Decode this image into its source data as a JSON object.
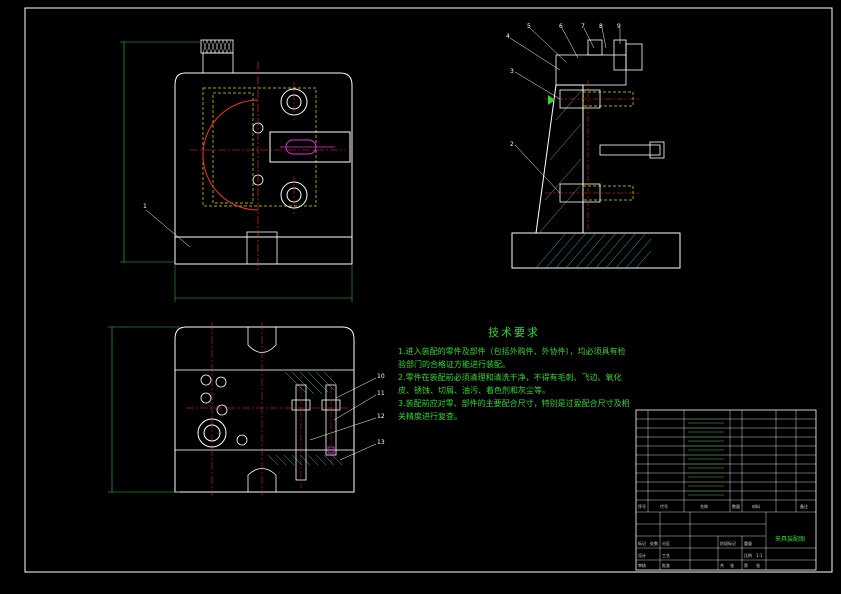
{
  "colors": {
    "background": "#000000",
    "frame": "#ffffff",
    "part_outline": "#ffffff",
    "hidden_lines": "#e8e000",
    "center_lines": "#ff2a2a",
    "magenta_feature": "#e030e0",
    "hatch": "#30c0c0",
    "notes_text": "#2bd92b",
    "dimension": "#30d030"
  },
  "tech_requirements": {
    "title": "技术要求",
    "items": [
      "1.进入装配的零件及部件（包括外购件、外协件），均必须具有检验部门的合格证方能进行装配。",
      "2.零件在装配前必须清理和清洗干净，不得有毛刺、飞边、氧化皮、锈蚀、切屑、油污、着色剂和灰尘等。",
      "3.装配前应对零、部件的主要配合尺寸，特别是过盈配合尺寸及相关精度进行复查。"
    ]
  },
  "views": {
    "front_view_label": "1",
    "side_view_labels": [
      "4",
      "5",
      "6",
      "7",
      "8",
      "9",
      "3",
      "2"
    ],
    "bottom_view_labels": [
      "10",
      "11",
      "12",
      "13"
    ]
  },
  "title_block": {
    "drawing_title": "夹具装配图",
    "header_cells": [
      "序号",
      "代号",
      "名称",
      "数量",
      "材料",
      "备注"
    ],
    "approval_cells": [
      "标记",
      "处数",
      "分区",
      "设计",
      "审核",
      "工艺",
      "批准"
    ],
    "scale_cells": [
      "阶段标记",
      "重量",
      "比例",
      "1:1"
    ],
    "sheet_cells": [
      "共",
      "张",
      "第",
      "张"
    ]
  }
}
